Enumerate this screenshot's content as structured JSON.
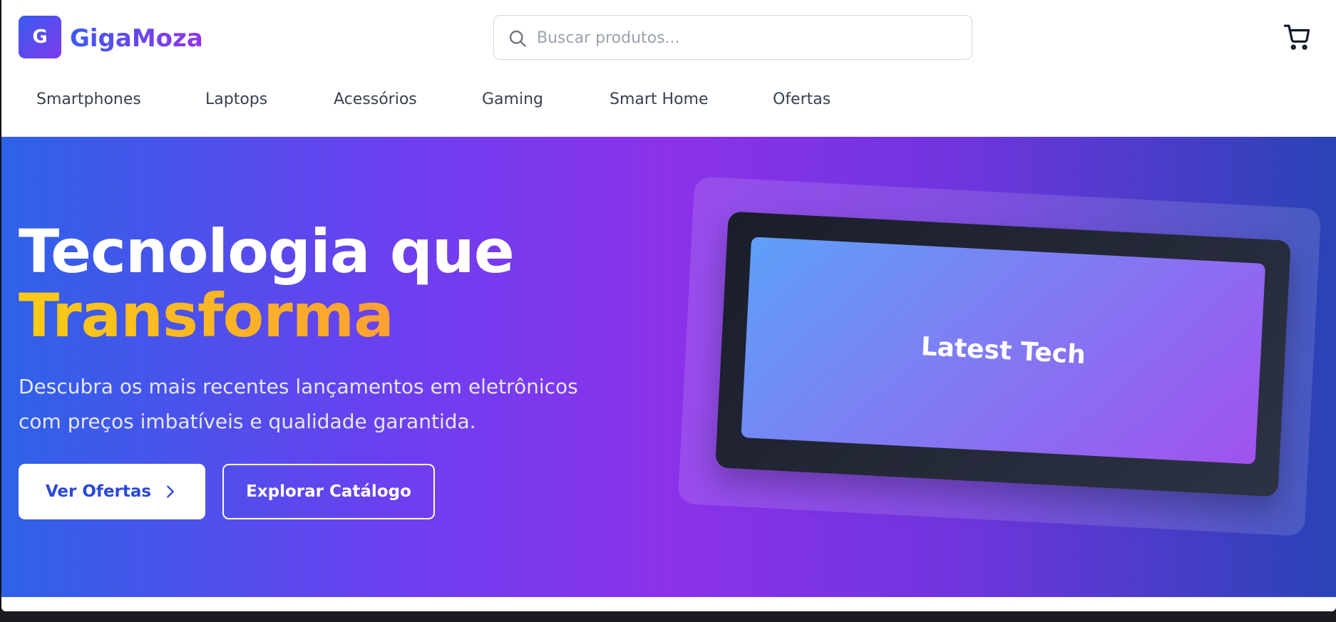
{
  "brand": {
    "badge": "G",
    "name": "GigaMoza"
  },
  "search": {
    "placeholder": "Buscar produtos...",
    "value": ""
  },
  "nav": {
    "items": [
      {
        "label": "Smartphones"
      },
      {
        "label": "Laptops"
      },
      {
        "label": "Acessórios"
      },
      {
        "label": "Gaming"
      },
      {
        "label": "Smart Home"
      },
      {
        "label": "Ofertas"
      }
    ]
  },
  "hero": {
    "title_line1": "Tecnologia que",
    "title_line2": "Transforma",
    "subtitle": "Descubra os mais recentes lançamentos em eletrônicos com preços imbatíveis e qualidade garantida.",
    "primary_button": "Ver Ofertas",
    "secondary_button": "Explorar Catálogo",
    "showcase_label": "Latest Tech"
  },
  "colors": {
    "brand_blue": "#3b5bf0",
    "brand_purple": "#7c3aed",
    "accent_yellow": "#facc15",
    "accent_orange": "#fb923c"
  },
  "icons": {
    "search": "search-icon",
    "cart": "cart-icon",
    "chevron": "chevron-right-icon"
  }
}
